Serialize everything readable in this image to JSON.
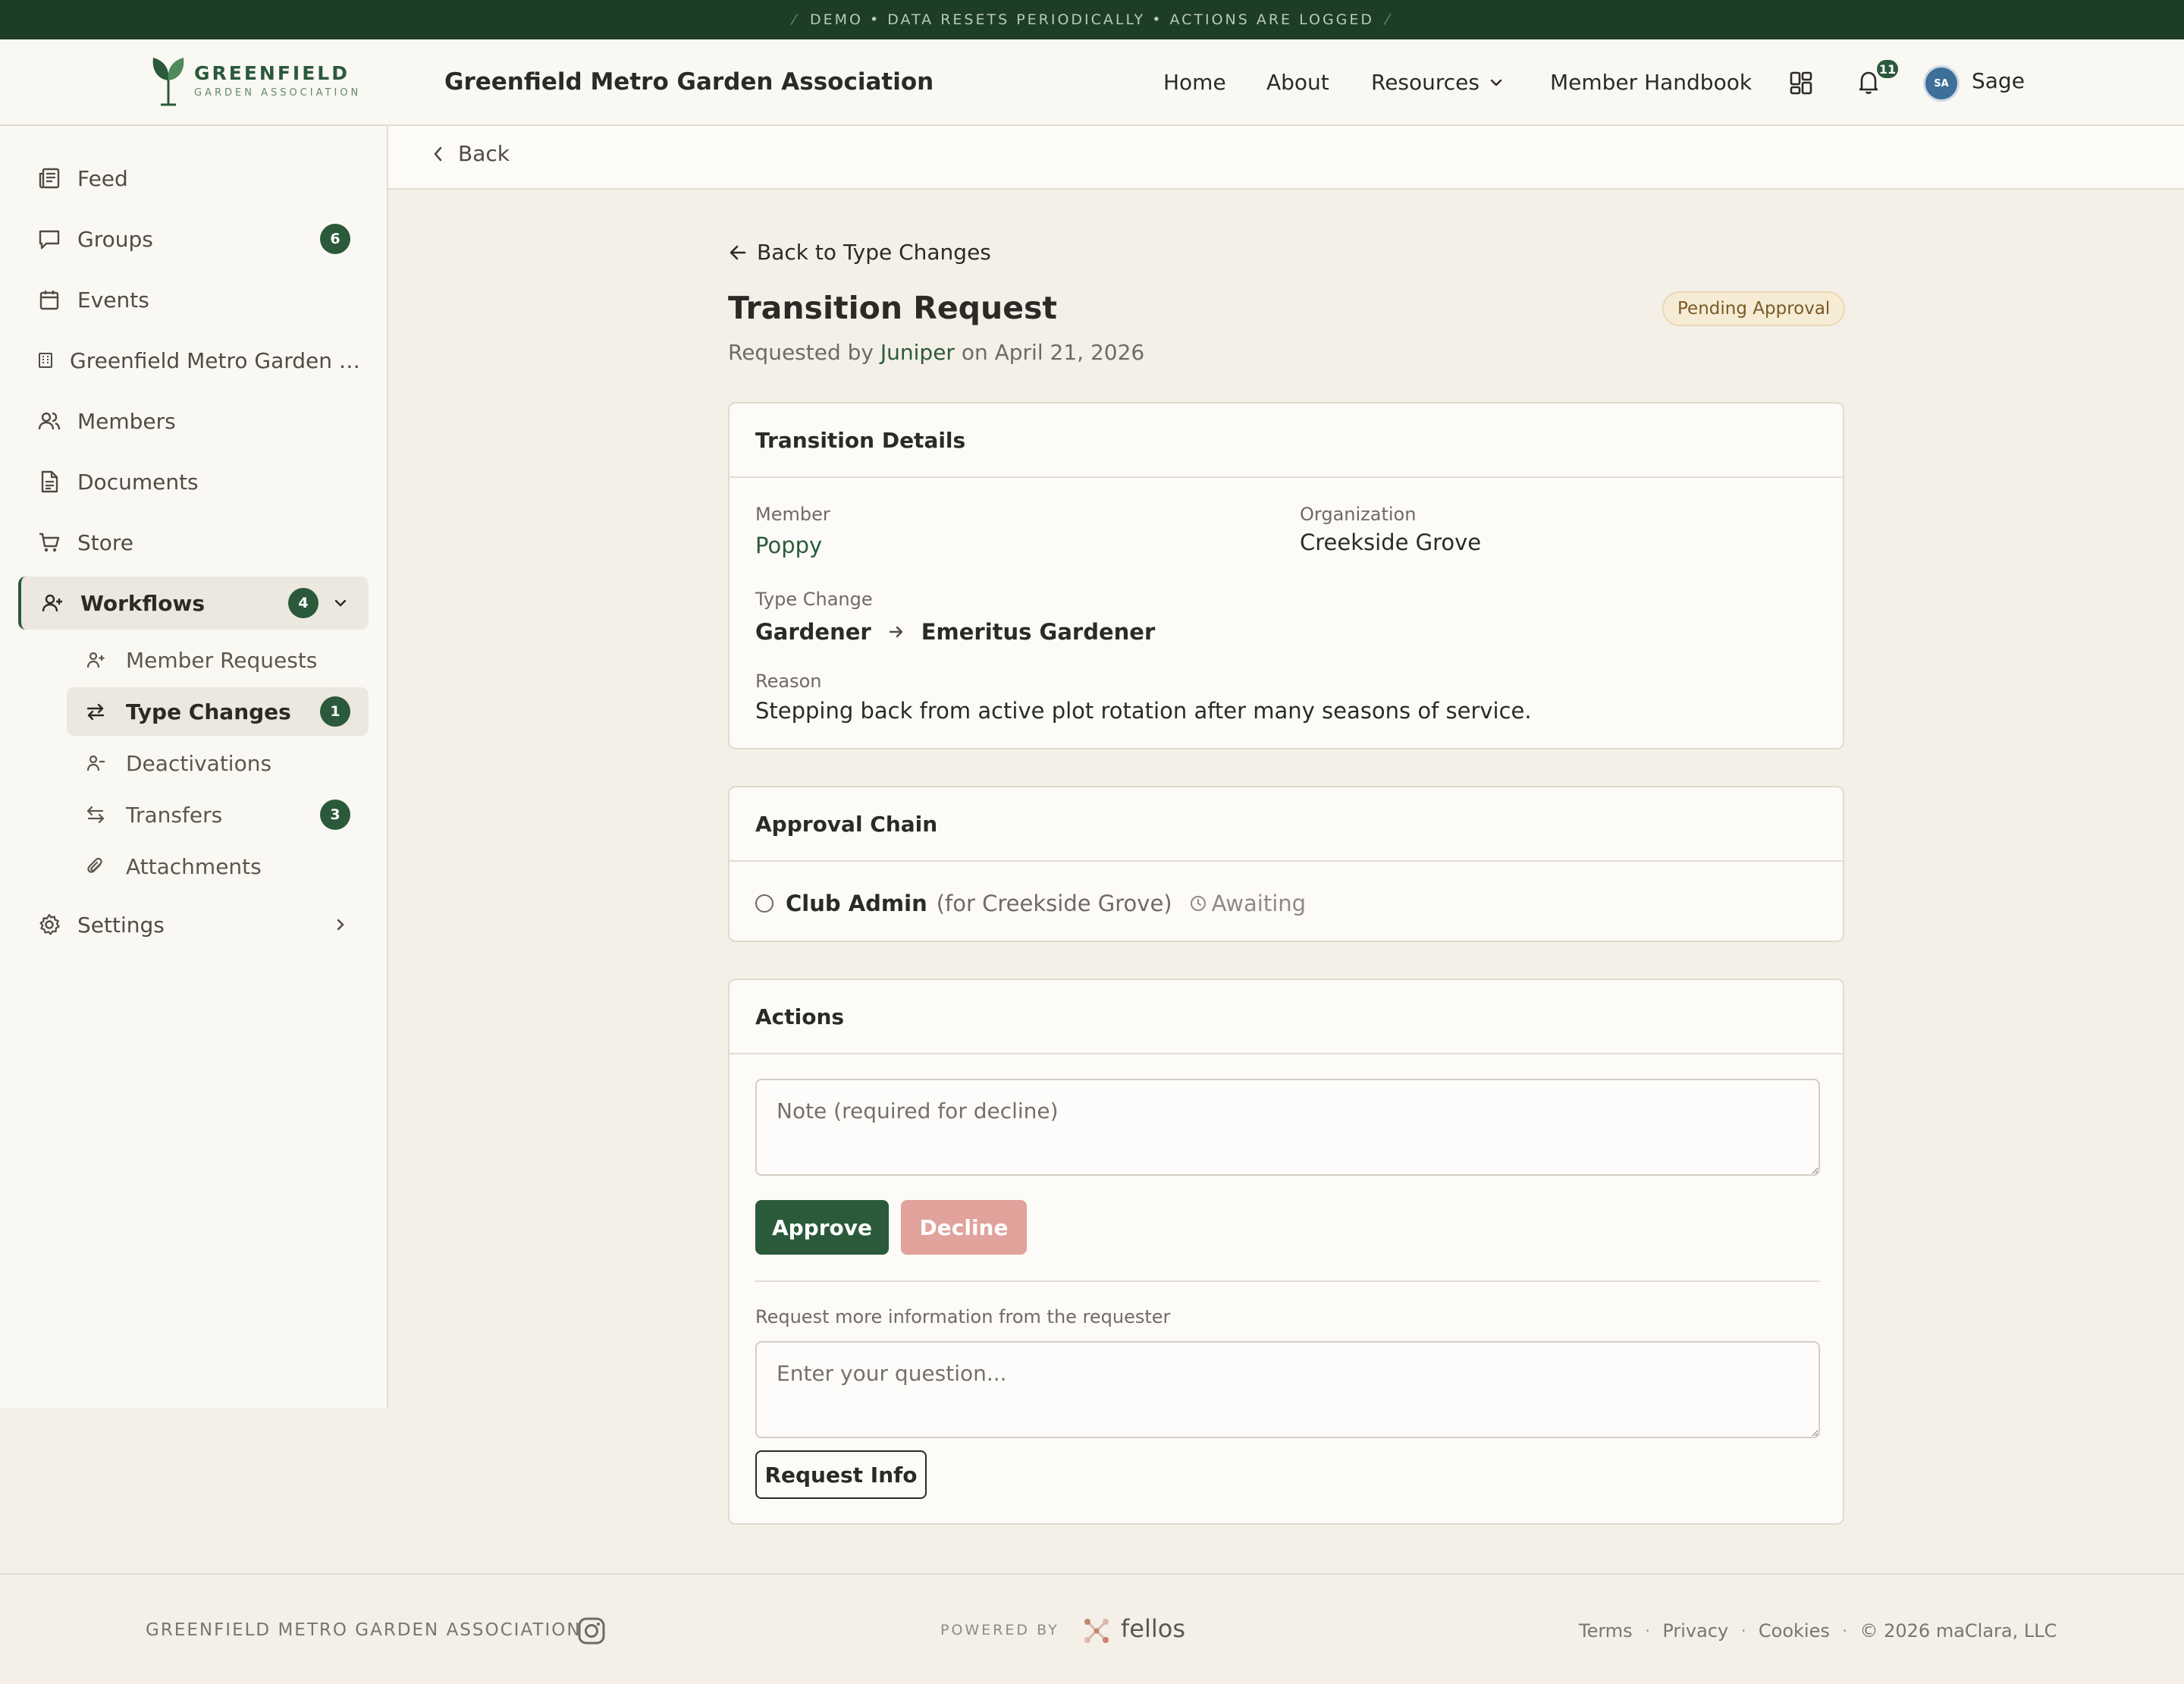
{
  "banner": {
    "text": "DEMO • DATA RESETS PERIODICALLY • ACTIONS ARE LOGGED"
  },
  "header": {
    "logo_name": "GREENFIELD",
    "logo_sub": "GARDEN ASSOCIATION",
    "org_title": "Greenfield Metro Garden Association",
    "nav": {
      "home": "Home",
      "about": "About",
      "resources": "Resources",
      "handbook": "Member Handbook"
    },
    "notification_count": "11",
    "avatar_initials": "SA",
    "user_name": "Sage"
  },
  "sidebar": {
    "items": [
      {
        "label": "Feed",
        "icon": "newspaper-icon"
      },
      {
        "label": "Groups",
        "icon": "chat-bubble-icon",
        "badge": "6"
      },
      {
        "label": "Events",
        "icon": "calendar-icon"
      },
      {
        "label": "Greenfield Metro Garden Association",
        "icon": "building-icon"
      },
      {
        "label": "Members",
        "icon": "users-icon"
      },
      {
        "label": "Documents",
        "icon": "document-icon"
      },
      {
        "label": "Store",
        "icon": "cart-icon"
      }
    ],
    "workflows": {
      "label": "Workflows",
      "badge": "4",
      "icon": "user-plus-icon"
    },
    "sub_items": [
      {
        "label": "Member Requests",
        "icon": "user-plus-icon"
      },
      {
        "label": "Type Changes",
        "icon": "swap-icon",
        "badge": "1"
      },
      {
        "label": "Deactivations",
        "icon": "user-minus-icon"
      },
      {
        "label": "Transfers",
        "icon": "transfer-icon",
        "badge": "3"
      },
      {
        "label": "Attachments",
        "icon": "paperclip-icon"
      }
    ],
    "settings": {
      "label": "Settings",
      "icon": "gear-icon"
    }
  },
  "backbar": {
    "label": "Back"
  },
  "main": {
    "crumb": "Back to Type Changes",
    "title": "Transition Request",
    "status": "Pending Approval",
    "requested_prefix": "Requested by",
    "requester": "Juniper",
    "requested_on": "on April 21, 2026",
    "details": {
      "heading": "Transition Details",
      "member_label": "Member",
      "member": "Poppy",
      "org_label": "Organization",
      "org": "Creekside Grove",
      "type_label": "Type Change",
      "from_type": "Gardener",
      "to_type": "Emeritus Gardener",
      "reason_label": "Reason",
      "reason": "Stepping back from active plot rotation after many seasons of service."
    },
    "approval": {
      "heading": "Approval Chain",
      "role": "Club Admin",
      "scope": "(for Creekside Grove)",
      "state": "Awaiting"
    },
    "actions": {
      "heading": "Actions",
      "note_placeholder": "Note (required for decline)",
      "approve": "Approve",
      "decline": "Decline",
      "info_label": "Request more information from the requester",
      "question_placeholder": "Enter your question...",
      "request_info": "Request Info"
    }
  },
  "footer": {
    "org": "GREENFIELD METRO GARDEN ASSOCIATION",
    "powered_by": "POWERED BY",
    "brand": "fellos",
    "terms": "Terms",
    "privacy": "Privacy",
    "cookies": "Cookies",
    "copyright": "© 2026 maClara, LLC"
  },
  "colors": {
    "brand_green": "#2a5a3a",
    "banner_bg": "#1d3d26",
    "decline": "#e0a29b",
    "pending_bg": "#f6ecd6"
  }
}
